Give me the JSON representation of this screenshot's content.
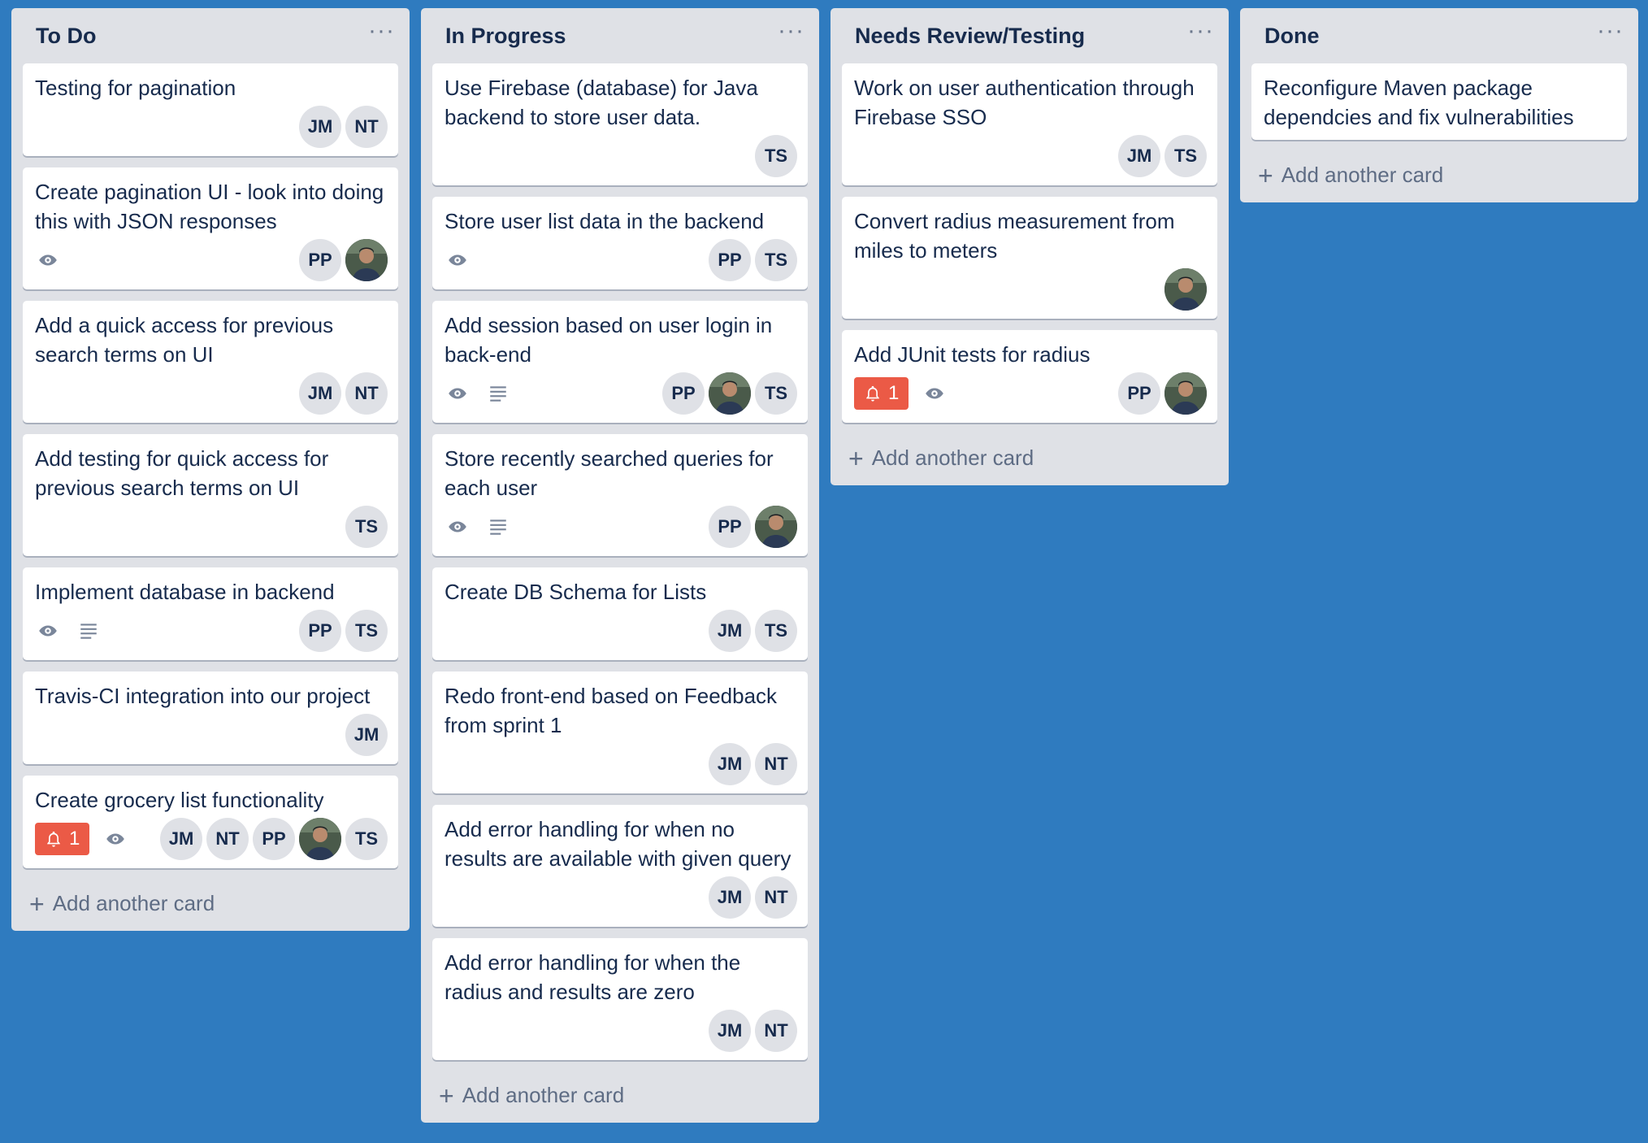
{
  "board": {
    "lists": [
      {
        "title": "To Do",
        "menu": "···",
        "add_card": "Add another card",
        "cards": [
          {
            "title": "Testing for pagination",
            "badges": [],
            "members": [
              "JM",
              "NT"
            ]
          },
          {
            "title": "Create pagination UI - look into doing this with JSON responses",
            "badges": [
              "watch"
            ],
            "members": [
              "PP",
              "photo"
            ]
          },
          {
            "title": "Add a quick access for previous search terms on UI",
            "badges": [],
            "members": [
              "JM",
              "NT"
            ]
          },
          {
            "title": "Add testing for quick access for previous search terms on UI",
            "badges": [],
            "members": [
              "TS"
            ]
          },
          {
            "title": "Implement database in backend",
            "badges": [
              "watch",
              "description"
            ],
            "members": [
              "PP",
              "TS"
            ]
          },
          {
            "title": "Travis-CI integration into our project",
            "badges": [],
            "members": [
              "JM"
            ]
          },
          {
            "title": "Create grocery list functionality",
            "notification": "1",
            "badges": [
              "watch"
            ],
            "members": [
              "JM",
              "NT",
              "PP",
              "photo",
              "TS"
            ]
          }
        ]
      },
      {
        "title": "In Progress",
        "menu": "···",
        "add_card": "Add another card",
        "cards": [
          {
            "title": "Use Firebase (database) for Java backend to store user data.",
            "badges": [],
            "members": [
              "TS"
            ]
          },
          {
            "title": "Store user list data in the backend",
            "badges": [
              "watch"
            ],
            "members": [
              "PP",
              "TS"
            ]
          },
          {
            "title": "Add session based on user login in back-end",
            "badges": [
              "watch",
              "description"
            ],
            "members": [
              "PP",
              "photo",
              "TS"
            ]
          },
          {
            "title": "Store recently searched queries for each user",
            "badges": [
              "watch",
              "description"
            ],
            "members": [
              "PP",
              "photo"
            ]
          },
          {
            "title": "Create DB Schema for Lists",
            "badges": [],
            "members": [
              "JM",
              "TS"
            ]
          },
          {
            "title": "Redo front-end based on Feedback from sprint 1",
            "badges": [],
            "members": [
              "JM",
              "NT"
            ]
          },
          {
            "title": "Add error handling for when no results are available with given query",
            "badges": [],
            "members": [
              "JM",
              "NT"
            ]
          },
          {
            "title": "Add error handling for when the radius and results are zero",
            "badges": [],
            "members": [
              "JM",
              "NT"
            ]
          }
        ]
      },
      {
        "title": "Needs Review/Testing",
        "menu": "···",
        "add_card": "Add another card",
        "cards": [
          {
            "title": "Work on user authentication through Firebase SSO",
            "badges": [],
            "members": [
              "JM",
              "TS"
            ]
          },
          {
            "title": "Convert radius measurement from miles to meters",
            "badges": [],
            "members": [
              "photo"
            ]
          },
          {
            "title": "Add JUnit tests for radius",
            "notification": "1",
            "badges": [
              "watch"
            ],
            "members": [
              "PP",
              "photo"
            ]
          }
        ]
      },
      {
        "title": "Done",
        "menu": "···",
        "add_card": "Add another card",
        "cards": [
          {
            "title": "Reconfigure Maven package dependcies and fix vulnerabilities",
            "badges": [],
            "members": []
          }
        ]
      }
    ]
  }
}
